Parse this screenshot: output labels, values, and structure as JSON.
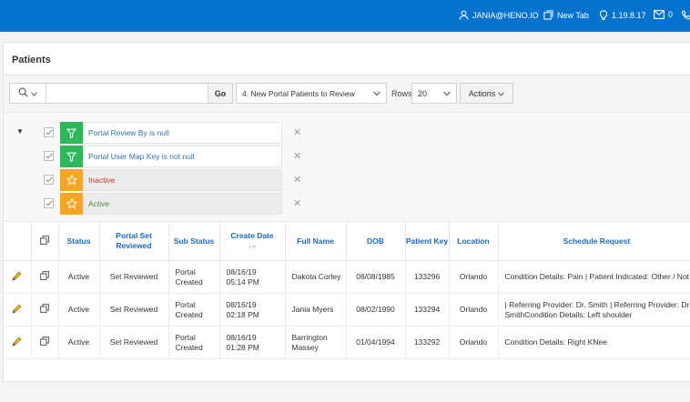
{
  "header": {
    "user": "JANIA@HENO.IO",
    "new_tab": "New Tab",
    "version": "1.19.8.17",
    "messages_count": "0",
    "colors": {
      "bar": "#0572ce"
    }
  },
  "page": {
    "title": "Patients"
  },
  "toolbar": {
    "search_placeholder": "",
    "go_label": "Go",
    "report_selected": "4. New Portal Patients to Review",
    "rows_label": "Rows",
    "rows_selected": "20",
    "actions_label": "Actions"
  },
  "filters": [
    {
      "label": "Portal Review By is null",
      "icon": "filter-icon",
      "type": "filter"
    },
    {
      "label": "Portal User Map Key is not null",
      "icon": "filter-icon",
      "type": "filter"
    },
    {
      "label": "Inactive",
      "icon": "star-icon",
      "type": "highlight"
    },
    {
      "label": "Active",
      "icon": "star-icon",
      "type": "highlight"
    }
  ],
  "table": {
    "headers": {
      "status": "Status",
      "portal_set_reviewed": "Portal Set Reviewed",
      "sub_status": "Sub Status",
      "create_date": "Create Date",
      "full_name": "Full Name",
      "dob": "DOB",
      "patient_key": "Patient Key",
      "location": "Location",
      "schedule_request": "Schedule Request"
    },
    "rows": [
      {
        "status": "Active",
        "set_reviewed": "Set Reviewed",
        "sub_status": "Portal Created",
        "create_date": "08/16/19",
        "create_time": "05:14 PM",
        "full_name": "Dakota Corley",
        "dob": "08/08/1985",
        "patient_key": "133296",
        "location": "Orlando",
        "schedule_request": "Condition Details: Pain | Patient Indicated: Other / Not Sure"
      },
      {
        "status": "Active",
        "set_reviewed": "Set Reviewed",
        "sub_status": "Portal Created",
        "create_date": "08/16/19",
        "create_time": "02:18 PM",
        "full_name": "Jania Myers",
        "dob": "08/02/1990",
        "patient_key": "133294",
        "location": "Orlando",
        "schedule_request": "| Referring Provider: Dr. Smith | Referring Provider: Dr. SmithCondition Details: Left shoulder"
      },
      {
        "status": "Active",
        "set_reviewed": "Set Reviewed",
        "sub_status": "Portal Created",
        "create_date": "08/16/19",
        "create_time": "01:28 PM",
        "full_name": "Barrington Massey",
        "dob": "01/04/1994",
        "patient_key": "133292",
        "location": "Orlando",
        "schedule_request": "Condition Details: Right KNee"
      }
    ]
  }
}
